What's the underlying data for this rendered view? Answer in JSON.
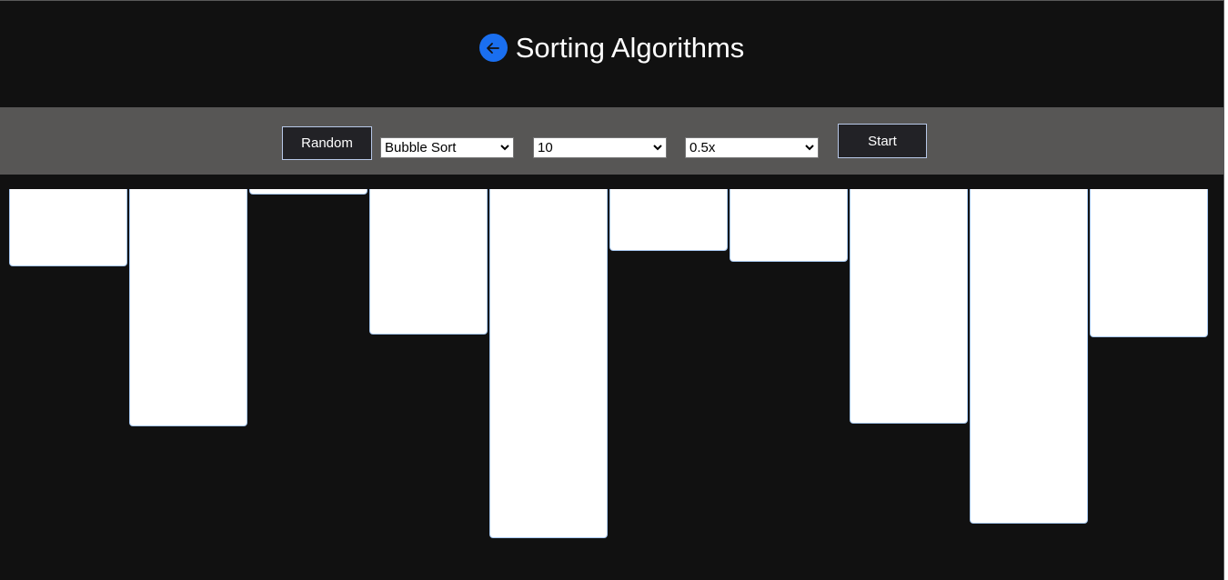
{
  "header": {
    "title": "Sorting Algorithms",
    "back_icon": "arrow-left-icon",
    "back_color": "#1a6ff0"
  },
  "toolbar": {
    "random_label": "Random",
    "algorithm_selected": "Bubble Sort",
    "size_selected": "10",
    "speed_selected": "0.5x",
    "start_label": "Start"
  },
  "bars": {
    "count": 10,
    "heights": [
      85,
      261,
      6,
      160,
      384,
      68,
      80,
      258,
      368,
      163
    ]
  },
  "colors": {
    "background": "#111111",
    "toolbar": "#575655",
    "bar_fill": "#ffffff",
    "bar_border": "#a8c8f0"
  }
}
